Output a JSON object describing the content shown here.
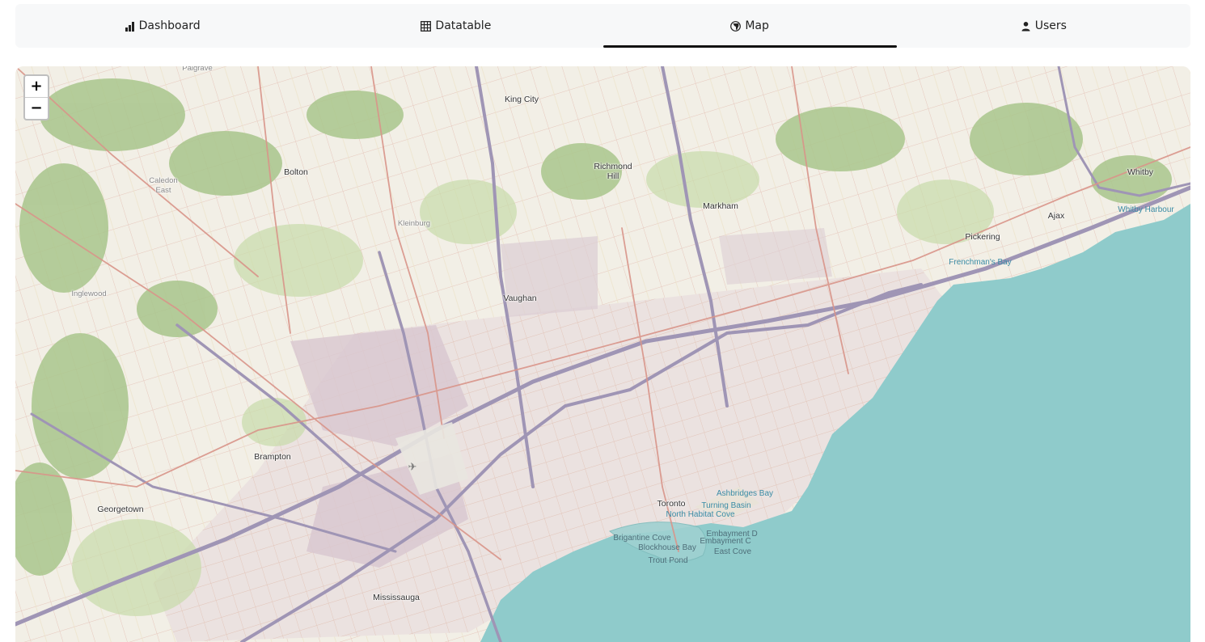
{
  "tabs": [
    {
      "label": "Dashboard",
      "icon": "bar-chart-icon",
      "active": false
    },
    {
      "label": "Datatable",
      "icon": "table-icon",
      "active": false
    },
    {
      "label": "Map",
      "icon": "globe-icon",
      "active": true
    },
    {
      "label": "Users",
      "icon": "user-icon",
      "active": false
    }
  ],
  "map": {
    "zoom_in": "+",
    "zoom_out": "−",
    "labels": {
      "king_city": "King City",
      "richmond_hill": "Richmond\nHill",
      "bolton": "Bolton",
      "caledon_east": "Caledon\nEast",
      "palgrave": "Palgrave",
      "kleinburg": "Kleinburg",
      "markham": "Markham",
      "whitby": "Whitby",
      "whitby_harbour": "Whitby Harbour",
      "ajax": "Ajax",
      "pickering": "Pickering",
      "frenchmans_bay": "Frenchman's Bay",
      "inglewood": "Inglewood",
      "vaughan": "Vaughan",
      "brampton": "Brampton",
      "georgetown": "Georgetown",
      "toronto": "Toronto",
      "ashbridges_bay": "Ashbridges Bay",
      "turning_basin": "Turning Basin",
      "north_habitat_cove": "North Habitat Cove",
      "brigantine_cove": "Brigantine Cove",
      "blockhouse_bay": "Blockhouse Bay",
      "trout_pond": "Trout Pond",
      "embayment_d": "Embayment D",
      "embayment_c": "Embayment C",
      "east_cove": "East Cove",
      "mississauga": "Mississauga"
    }
  },
  "colors": {
    "land": "#f2efe6",
    "water": "#8fcbcb",
    "forest": "#a7c48a",
    "major_road": "#9f95b5",
    "arterial": "#d9a39a",
    "residential": "#e3c9c0",
    "urban": "#ddd0d4"
  }
}
